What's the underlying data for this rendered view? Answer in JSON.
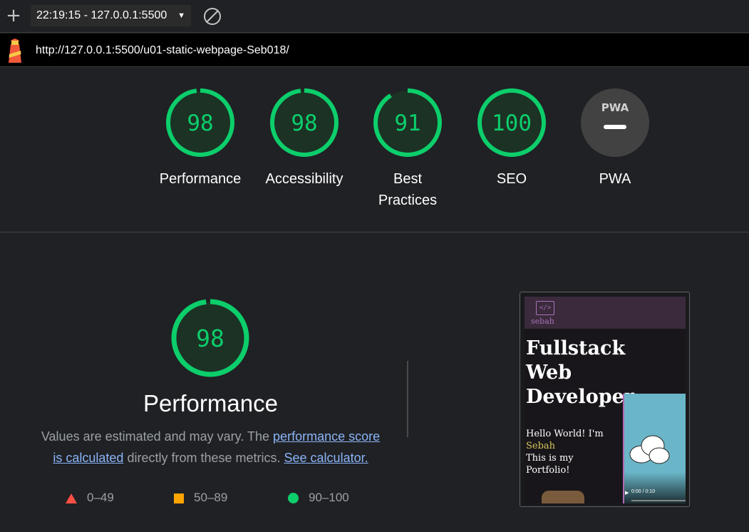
{
  "toolbar": {
    "new_report_icon": "plus-icon",
    "report_label": "22:19:15 - 127.0.0.1:5500",
    "clear_icon": "clear-icon"
  },
  "urlbar": {
    "logo_icon": "lighthouse-icon",
    "url": "http://127.0.0.1:5500/u01-static-webpage-Seb018/"
  },
  "colors": {
    "pass": "#0cce6b",
    "average": "#ffa400",
    "fail": "#ff4e42",
    "link": "#8ab4f8"
  },
  "gauges": [
    {
      "score": "98",
      "label": "Performance"
    },
    {
      "score": "98",
      "label": "Accessibility"
    },
    {
      "score": "91",
      "label": "Best Practices"
    },
    {
      "score": "100",
      "label": "SEO"
    },
    {
      "score": "PWA",
      "label": "PWA"
    }
  ],
  "performance": {
    "score": "98",
    "title": "Performance",
    "desc_pre": "Values are estimated and may vary. The ",
    "desc_link1": "performance score is calculated",
    "desc_mid": " directly from these metrics. ",
    "desc_link2": "See calculator.",
    "legend": [
      {
        "range": "0–49",
        "icon": "triangle-icon"
      },
      {
        "range": "50–89",
        "icon": "square-icon"
      },
      {
        "range": "90–100",
        "icon": "circle-icon"
      }
    ]
  },
  "screenshot": {
    "logo": "</>",
    "brand": "sebah",
    "hero_lines": [
      "Fullstack",
      "Web",
      "Developer"
    ],
    "intro_1": "Hello World! I'm",
    "intro_name": "Sebah",
    "intro_2": "This is my",
    "intro_3": "Portfolio!",
    "video_time": "0:00 / 0:10"
  }
}
